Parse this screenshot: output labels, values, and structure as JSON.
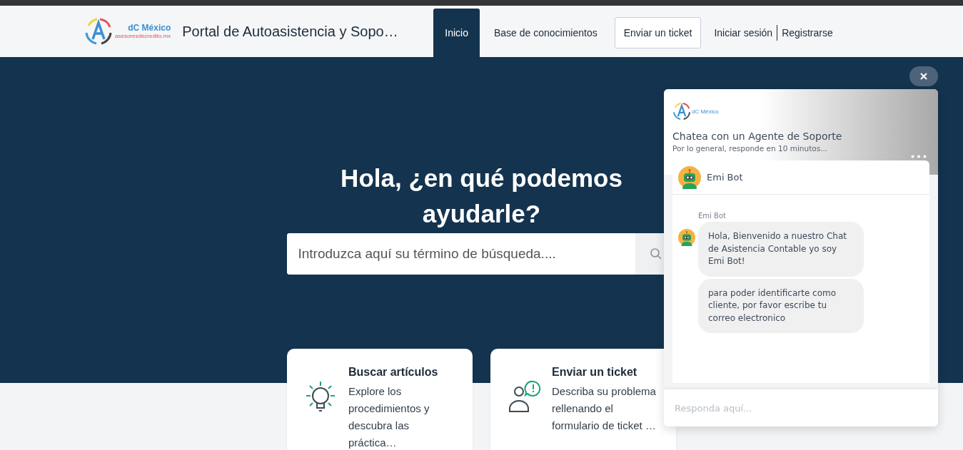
{
  "header": {
    "logo": {
      "name": "dC México",
      "tagline": "asesoresdecredito.mx"
    },
    "title": "Portal de Autoasistencia y Sopo…",
    "nav": [
      {
        "label": "Inicio",
        "kind": "tab",
        "selected": true
      },
      {
        "label": "Base de conocimientos",
        "kind": "tab",
        "selected": false
      },
      {
        "label": "Enviar un ticket",
        "kind": "outlined",
        "selected": false
      },
      {
        "label": "Iniciar sesión",
        "kind": "link",
        "selected": false
      },
      {
        "label": "Registrarse",
        "kind": "link",
        "selected": false
      }
    ]
  },
  "hero": {
    "heading": "Hola, ¿en qué podemos ayudarle?",
    "search": {
      "placeholder": "Introduzca aquí su término de búsqueda...."
    }
  },
  "cards": [
    {
      "title": "Buscar artículos",
      "text": "Explore los procedimientos y descubra las práctica…"
    },
    {
      "title": "Enviar un ticket",
      "text": "Describa su problema rellenando el formulario de ticket …"
    }
  ],
  "chat": {
    "logo": "dC México",
    "title": "Chatea con un Agente de Soporte",
    "subtitle": "Por lo general, responde en 10 minutos...",
    "agent": "Emi Bot",
    "messages": [
      {
        "sender": "Emi Bot",
        "bubbles": [
          "Hola, Bienvenido a nuestro Chat de Asistencia Contable yo soy Emi Bot!",
          "para poder identificarte como cliente, por favor escribe tu correo electronico"
        ]
      }
    ],
    "input": {
      "placeholder": "Responda aquí..."
    }
  }
}
